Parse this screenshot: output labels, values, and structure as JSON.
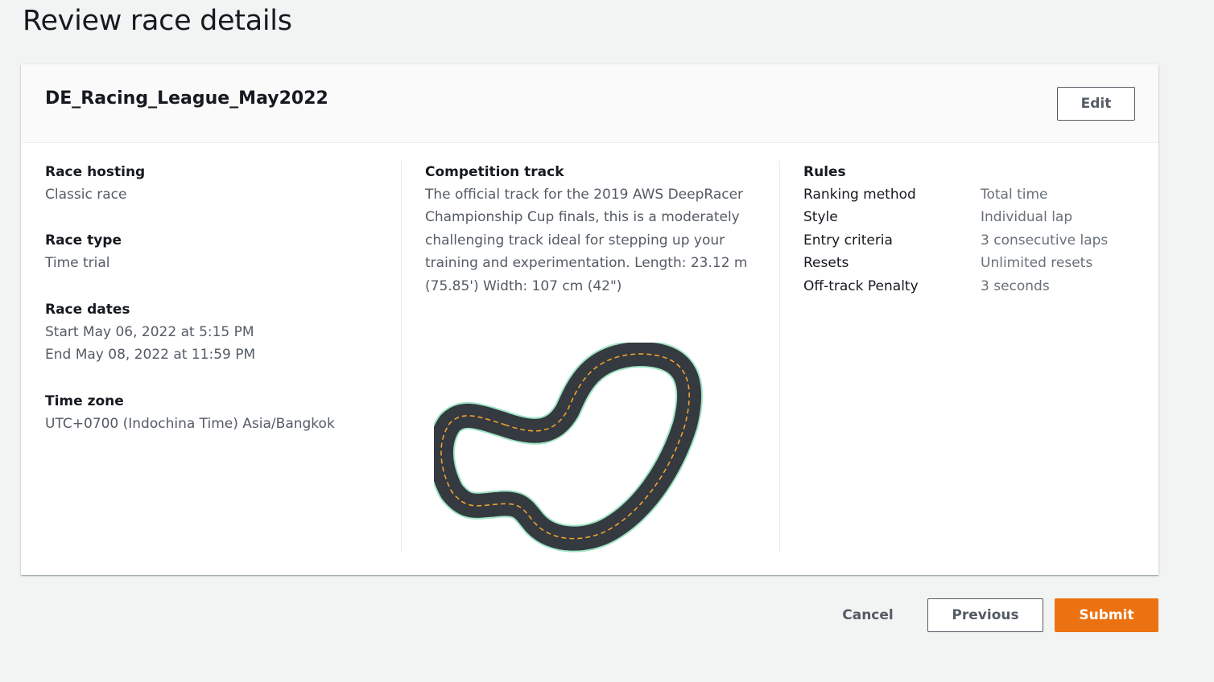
{
  "page": {
    "title": "Review race details"
  },
  "card": {
    "title": "DE_Racing_League_May2022",
    "edit_label": "Edit"
  },
  "details": {
    "race_hosting": {
      "label": "Race hosting",
      "value": "Classic race"
    },
    "race_type": {
      "label": "Race type",
      "value": "Time trial"
    },
    "race_dates": {
      "label": "Race dates",
      "start": "Start May 06, 2022 at 5:15 PM",
      "end": "End May 08, 2022 at 11:59 PM"
    },
    "time_zone": {
      "label": "Time zone",
      "value": "UTC+0700 (Indochina Time) Asia/Bangkok"
    }
  },
  "track": {
    "label": "Competition track",
    "description": "The official track for the 2019 AWS DeepRacer Championship Cup finals, this is a moderately challenging track ideal for stepping up your training and experimentation. Length: 23.12 m (75.85') Width: 107 cm (42\")"
  },
  "rules": {
    "label": "Rules",
    "items": [
      {
        "key": "Ranking method",
        "value": "Total time"
      },
      {
        "key": "Style",
        "value": "Individual lap"
      },
      {
        "key": "Entry criteria",
        "value": "3 consecutive laps"
      },
      {
        "key": "Resets",
        "value": "Unlimited resets"
      },
      {
        "key": "Off-track Penalty",
        "value": "3 seconds"
      }
    ]
  },
  "footer": {
    "cancel_label": "Cancel",
    "previous_label": "Previous",
    "submit_label": "Submit"
  },
  "colors": {
    "accent": "#ec7211",
    "track_asphalt": "#343a40",
    "track_center_line": "#f0a030",
    "track_edge": "#9fe3c4"
  }
}
